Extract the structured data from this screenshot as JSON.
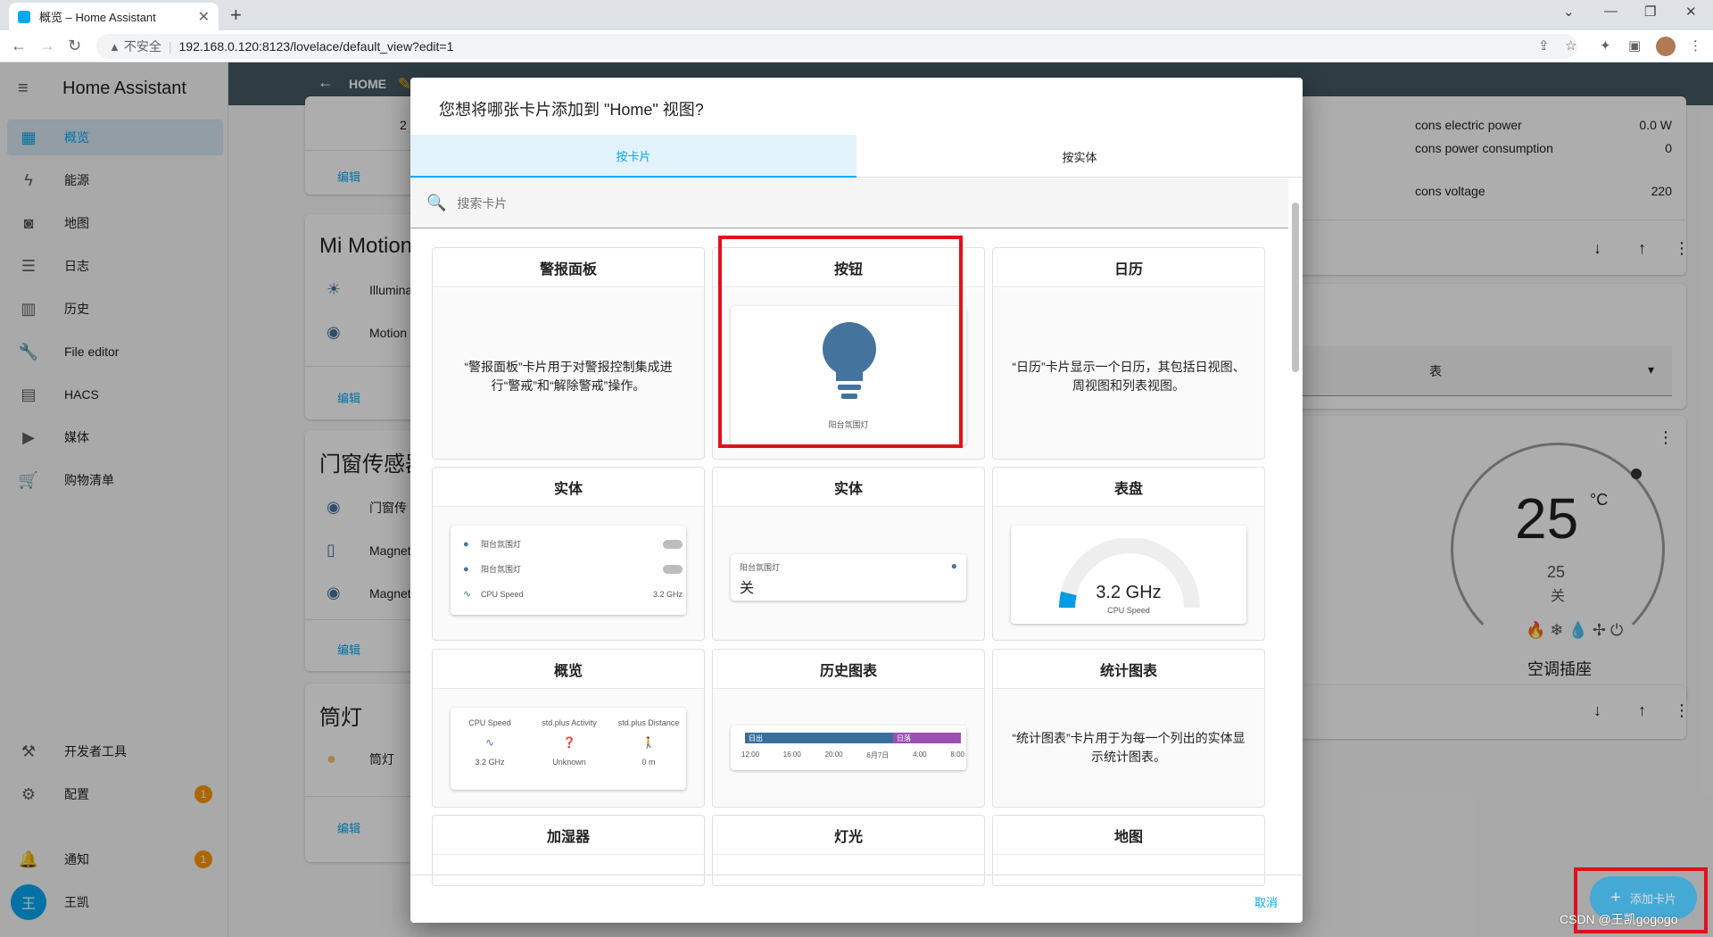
{
  "browser": {
    "tab_title": "概览 – Home Assistant",
    "url": "192.168.0.120:8123/lovelace/default_view?edit=1",
    "security_label": "不安全"
  },
  "sidebar": {
    "app_title": "Home Assistant",
    "items": [
      {
        "label": "概览",
        "icon": "dashboard-icon"
      },
      {
        "label": "能源",
        "icon": "lightning-icon"
      },
      {
        "label": "地图",
        "icon": "map-icon"
      },
      {
        "label": "日志",
        "icon": "list-icon"
      },
      {
        "label": "历史",
        "icon": "chart-icon"
      },
      {
        "label": "File editor",
        "icon": "wrench-icon"
      },
      {
        "label": "HACS",
        "icon": "hacs-icon"
      },
      {
        "label": "媒体",
        "icon": "media-icon"
      },
      {
        "label": "购物清单",
        "icon": "cart-icon"
      }
    ],
    "dev_tools": "开发者工具",
    "settings": "配置",
    "settings_badge": "1",
    "notifications": "通知",
    "notifications_badge": "1",
    "user_name": "王凯",
    "user_initial": "王"
  },
  "header": {
    "view_name": "HOME"
  },
  "background": {
    "edit_label": "编辑",
    "card_number": "2",
    "mi_motion_title": "Mi Motion",
    "mi_rows": [
      "Illumina",
      "Motion"
    ],
    "door_title": "门窗传感器",
    "door_rows": [
      "门窗传",
      "Magnet",
      "Magnet"
    ],
    "lamp_title": "筒灯",
    "lamp_row": "筒灯",
    "right_rows": [
      {
        "label": "cons electric power",
        "value": "0.0 W"
      },
      {
        "label": "cons power consumption",
        "value": "0"
      },
      {
        "label": "cons voltage",
        "value": "220"
      }
    ],
    "select_text": "表",
    "thermo_temp": "25",
    "thermo_unit": "°C",
    "thermo_target": "25",
    "thermo_state": "关",
    "thermo_name": "空调插座"
  },
  "dialog": {
    "title": "您想将哪张卡片添加到 \"Home\" 视图?",
    "tab_by_card": "按卡片",
    "tab_by_entity": "按实体",
    "search_placeholder": "搜索卡片",
    "cancel": "取消",
    "cards": {
      "alarm": {
        "title": "警报面板",
        "desc": "“警报面板”卡片用于对警报控制集成进行“警戒”和“解除警戒”操作。"
      },
      "button": {
        "title": "按钮",
        "preview_label": "阳台氛围灯"
      },
      "calendar": {
        "title": "日历",
        "desc": "“日历”卡片显示一个日历，其包括日视图、周视图和列表视图。"
      },
      "entities": {
        "title": "实体",
        "rows": [
          {
            "name": "阳台氛围灯",
            "value": ""
          },
          {
            "name": "阳台氛围灯",
            "value": ""
          },
          {
            "name": "CPU Speed",
            "value": "3.2 GHz"
          }
        ]
      },
      "entity": {
        "title": "实体",
        "name": "阳台氛围灯",
        "state": "关"
      },
      "gauge": {
        "title": "表盘",
        "value": "3.2 GHz",
        "label": "CPU Speed"
      },
      "glance": {
        "title": "概览",
        "items": [
          {
            "name": "CPU Speed",
            "value": "3.2 GHz"
          },
          {
            "name": "std.plus Activity",
            "value": "Unknown"
          },
          {
            "name": "std.plus Distance",
            "value": "0 m"
          }
        ]
      },
      "history": {
        "title": "历史图表",
        "bar_left": "日出",
        "bar_right": "日落",
        "ticks": [
          "12:00",
          "16:00",
          "20:00",
          "6月7日",
          "4:00",
          "8:00"
        ]
      },
      "statistics": {
        "title": "统计图表",
        "desc": "“统计图表”卡片用于为每一个列出的实体显示统计图表。"
      },
      "humidifier": {
        "title": "加湿器"
      },
      "light": {
        "title": "灯光"
      },
      "map": {
        "title": "地图"
      }
    }
  },
  "fab": {
    "label": "添加卡片"
  },
  "watermark": "CSDN @王凯gogogo",
  "colors": {
    "accent": "#03a9f4",
    "header": "#455a64",
    "highlight": "#e0111b",
    "bulb": "#44739e"
  }
}
